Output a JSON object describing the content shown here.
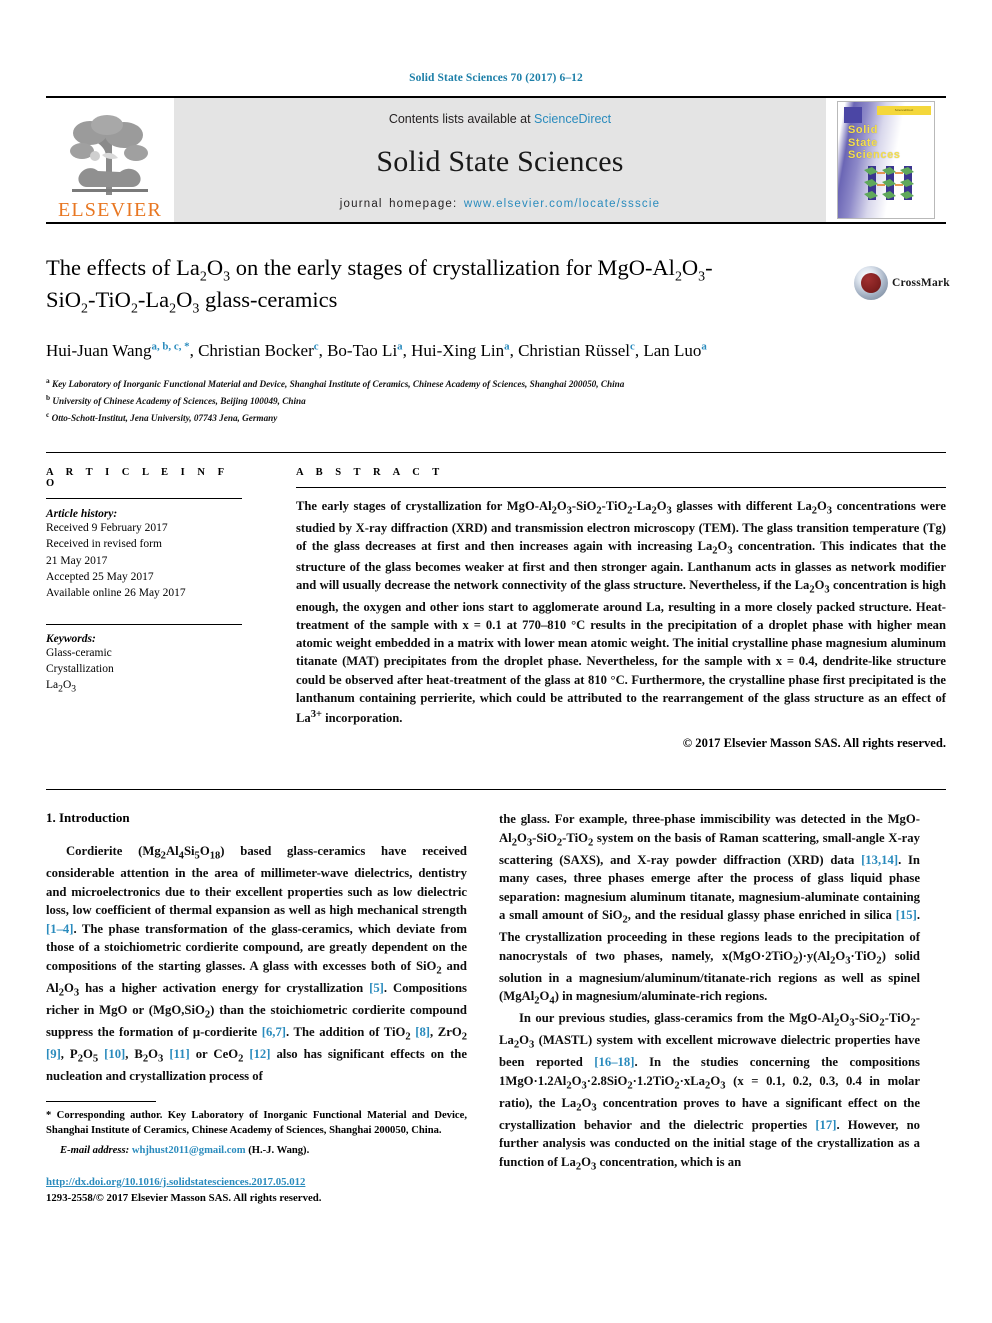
{
  "running_head": "Solid State Sciences 70 (2017) 6–12",
  "masthead": {
    "publisher_logo_word": "ELSEVIER",
    "publisher_logo_icon": "elsevier-tree-icon",
    "contents_prefix": "Contents lists available at ",
    "contents_link": "ScienceDirect",
    "journal_title": "Solid State Sciences",
    "homepage_prefix": "journal homepage: ",
    "homepage_url": "www.elsevier.com/locate/ssscie",
    "cover": {
      "title_lines": [
        "Solid",
        "State",
        "Sciences"
      ],
      "banner_text": "ScienceDirect",
      "accent_yellow": "#f6e04b",
      "accent_purple": "#6b66b5"
    }
  },
  "article": {
    "title_part1": "The effects of La",
    "title_sub1": "2",
    "title_part2": "O",
    "title_sub2": "3",
    "title_part3": " on the early stages of crystallization for MgO-Al",
    "title_sub3": "2",
    "title_part4": "O",
    "title_sub4": "3",
    "title_part5": "-SiO",
    "title_sub5": "2",
    "title_part6": "-TiO",
    "title_sub6": "2",
    "title_part7": "-La",
    "title_sub7": "2",
    "title_part8": "O",
    "title_sub8": "3",
    "title_part9": " glass-ceramics",
    "title_plain": "The effects of La2O3 on the early stages of crystallization for MgO-Al2O3-SiO2-TiO2-La2O3 glass-ceramics",
    "crossmark_label": "CrossMark",
    "authors": [
      {
        "name": "Hui-Juan Wang",
        "marks": "a, b, c, *"
      },
      {
        "name": "Christian Bocker",
        "marks": "c"
      },
      {
        "name": "Bo-Tao Li",
        "marks": "a"
      },
      {
        "name": "Hui-Xing Lin",
        "marks": "a"
      },
      {
        "name": "Christian Rüssel",
        "marks": "c"
      },
      {
        "name": "Lan Luo",
        "marks": "a"
      }
    ],
    "affiliations": [
      {
        "mark": "a",
        "text": "Key Laboratory of Inorganic Functional Material and Device, Shanghai Institute of Ceramics, Chinese Academy of Sciences, Shanghai 200050, China"
      },
      {
        "mark": "b",
        "text": "University of Chinese Academy of Sciences, Beijing 100049, China"
      },
      {
        "mark": "c",
        "text": "Otto-Schott-Institut, Jena University, 07743 Jena, Germany"
      }
    ]
  },
  "article_info": {
    "heading": "A R T I C L E  I N F O",
    "history_label": "Article history:",
    "history_lines": [
      "Received 9 February 2017",
      "Received in revised form",
      "21 May 2017",
      "Accepted 25 May 2017",
      "Available online 26 May 2017"
    ],
    "keywords_label": "Keywords:",
    "keywords": [
      "Glass-ceramic",
      "Crystallization",
      "La2O3"
    ]
  },
  "abstract": {
    "heading": "A B S T R A C T",
    "paragraph": "The early stages of crystallization for MgO-Al2O3-SiO2-TiO2-La2O3 glasses with different La2O3 concentrations were studied by X-ray diffraction (XRD) and transmission electron microscopy (TEM). The glass transition temperature (Tg) of the glass decreases at first and then increases again with increasing La2O3 concentration. This indicates that the structure of the glass becomes weaker at first and then stronger again. Lanthanum acts in glasses as network modifier and will usually decrease the network connectivity of the glass structure. Nevertheless, if the La2O3 concentration is high enough, the oxygen and other ions start to agglomerate around La, resulting in a more closely packed structure. Heat-treatment of the sample with x = 0.1 at 770–810 °C results in the precipitation of a droplet phase with higher mean atomic weight embedded in a matrix with lower mean atomic weight. The initial crystalline phase magnesium aluminum titanate (MAT) precipitates from the droplet phase. Nevertheless, for the sample with x = 0.4, dendrite-like structure could be observed after heat-treatment of the glass at 810 °C. Furthermore, the crystalline phase first precipitated is the lanthanum containing perrierite, which could be attributed to the rearrangement of the glass structure as an effect of La3+ incorporation.",
    "copyright": "© 2017 Elsevier Masson SAS. All rights reserved."
  },
  "body": {
    "section_heading": "1. Introduction",
    "left_paragraphs": [
      "Cordierite (Mg2Al4Si5O18) based glass-ceramics have received considerable attention in the area of millimeter-wave dielectrics, dentistry and microelectronics due to their excellent properties such as low dielectric loss, low coefficient of thermal expansion as well as high mechanical strength [1–4]. The phase transformation of the glass-ceramics, which deviate from those of a stoichiometric cordierite compound, are greatly dependent on the compositions of the starting glasses. A glass with excesses both of SiO2 and Al2O3 has a higher activation energy for crystallization [5]. Compositions richer in MgO or (MgO,SiO2) than the stoichiometric cordierite compound suppress the formation of μ-cordierite [6,7]. The addition of TiO2 [8], ZrO2 [9], P2O5 [10], B2O3 [11] or CeO2 [12] also has significant effects on the nucleation and crystallization process of"
    ],
    "right_paragraphs": [
      "the glass. For example, three-phase immiscibility was detected in the MgO-Al2O3-SiO2-TiO2 system on the basis of Raman scattering, small-angle X-ray scattering (SAXS), and X-ray powder diffraction (XRD) data [13,14]. In many cases, three phases emerge after the process of glass liquid phase separation: magnesium aluminum titanate, magnesium-aluminate containing a small amount of SiO2, and the residual glassy phase enriched in silica [15]. The crystallization proceeding in these regions leads to the precipitation of nanocrystals of two phases, namely, x(MgO·2TiO2)·y(Al2O3·TiO2) solid solution in a magnesium/aluminum/titanate-rich regions as well as spinel (MgAl2O4) in magnesium/aluminate-rich regions.",
      "In our previous studies, glass-ceramics from the MgO-Al2O3-SiO2-TiO2-La2O3 (MASTL) system with excellent microwave dielectric properties have been reported [16–18]. In the studies concerning the compositions 1MgO·1.2Al2O3·2.8SiO2·1.2TiO2·xLa2O3 (x = 0.1, 0.2, 0.3, 0.4 in molar ratio), the La2O3 concentration proves to have a significant effect on the crystallization behavior and the dielectric properties [17]. However, no further analysis was conducted on the initial stage of the crystallization as a function of La2O3 concentration, which is an"
    ],
    "references_inline": [
      "[1–4]",
      "[5]",
      "[6,7]",
      "[8]",
      "[9]",
      "[10]",
      "[11]",
      "[12]",
      "[13,14]",
      "[15]",
      "[16–18]",
      "[17]"
    ]
  },
  "footnotes": {
    "corresponding_mark": "*",
    "corresponding_text": "Corresponding author. Key Laboratory of Inorganic Functional Material and Device, Shanghai Institute of Ceramics, Chinese Academy of Sciences, Shanghai 200050, China.",
    "email_label": "E-mail address:",
    "email": "whjhust2011@gmail.com",
    "email_suffix": "(H.-J. Wang).",
    "doi_url": "http://dx.doi.org/10.1016/j.solidstatesciences.2017.05.012",
    "issn_line": "1293-2558/© 2017 Elsevier Masson SAS. All rights reserved."
  },
  "colors": {
    "link_blue": "#2a8bbd",
    "elsevier_orange": "#e87722",
    "masthead_grey": "#e4e4e4"
  }
}
